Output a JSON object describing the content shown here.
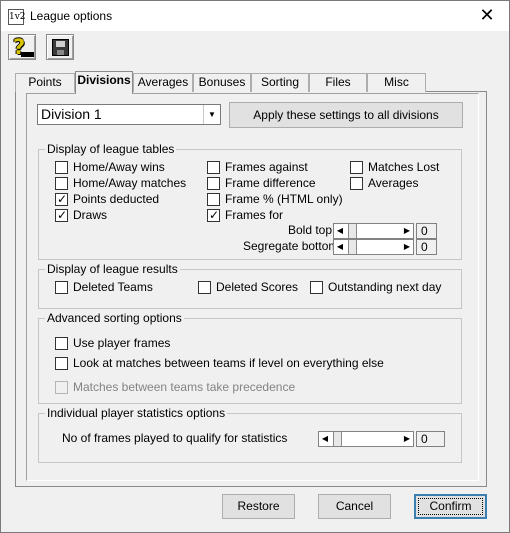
{
  "window": {
    "title": "League options",
    "app_icon_text": "1v2",
    "close_glyph": "✕"
  },
  "toolbar": {
    "help_icon": "help-question-icon",
    "save_icon": "floppy-disk-icon"
  },
  "tabs": [
    "Points",
    "Divisions",
    "Averages",
    "Bonuses",
    "Sorting",
    "Files",
    "Misc"
  ],
  "active_tab": "Divisions",
  "division_select": {
    "value": "Division 1"
  },
  "apply_button": "Apply these settings to all divisions",
  "league_tables": {
    "title": "Display of league tables",
    "col1": [
      {
        "label": "Home/Away wins",
        "checked": false
      },
      {
        "label": "Home/Away matches",
        "checked": false
      },
      {
        "label": "Points deducted",
        "checked": true
      },
      {
        "label": "Draws",
        "checked": true
      }
    ],
    "col2": [
      {
        "label": "Frames against",
        "checked": false
      },
      {
        "label": "Frame difference",
        "checked": false
      },
      {
        "label": "Frame % (HTML only)",
        "checked": false
      },
      {
        "label": "Frames for",
        "checked": true
      }
    ],
    "col3": [
      {
        "label": "Matches Lost",
        "checked": false
      },
      {
        "label": "Averages",
        "checked": false
      }
    ],
    "bold_top": {
      "label": "Bold top",
      "value": "0"
    },
    "segregate_bottom": {
      "label": "Segregate bottom",
      "value": "0"
    }
  },
  "league_results": {
    "title": "Display of league results",
    "items": [
      {
        "label": "Deleted Teams",
        "checked": false
      },
      {
        "label": "Deleted Scores",
        "checked": false
      },
      {
        "label": "Outstanding next day",
        "checked": false
      }
    ]
  },
  "sorting": {
    "title": "Advanced sorting options",
    "items": [
      {
        "label": "Use player frames",
        "checked": false,
        "enabled": true
      },
      {
        "label": "Look at matches between teams if level on everything else",
        "checked": false,
        "enabled": true
      },
      {
        "label": "Matches between teams take precedence",
        "checked": false,
        "enabled": false
      }
    ]
  },
  "player_stats": {
    "title": "Individual player statistics options",
    "label": "No of frames played to qualify for statistics",
    "value": "0"
  },
  "footer": {
    "restore": "Restore",
    "cancel": "Cancel",
    "confirm": "Confirm"
  }
}
